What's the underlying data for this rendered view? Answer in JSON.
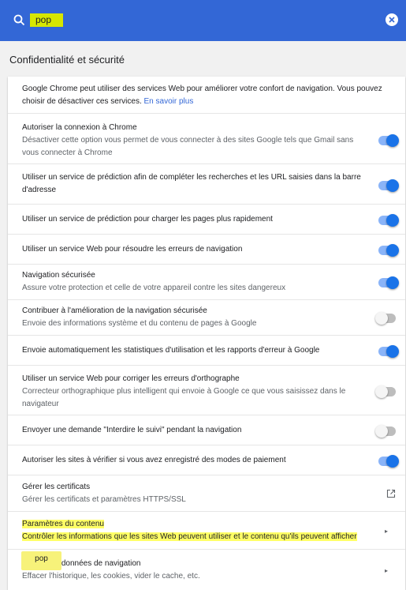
{
  "search": {
    "value": "pop"
  },
  "section": {
    "title": "Confidentialité et sécurité"
  },
  "intro": {
    "text": "Google Chrome peut utiliser des services Web pour améliorer votre confort de navigation. Vous pouvez choisir de désactiver ces services.",
    "link": "En savoir plus"
  },
  "settings": [
    {
      "label": "Autoriser la connexion à Chrome",
      "desc": "Désactiver cette option vous permet de vous connecter à des sites Google tels que Gmail sans vous connecter à Chrome",
      "state": "on"
    },
    {
      "label": "Utiliser un service de prédiction afin de compléter les recherches et les URL saisies dans la barre d'adresse",
      "desc": "",
      "state": "on"
    },
    {
      "label": "Utiliser un service de prédiction pour charger les pages plus rapidement",
      "desc": "",
      "state": "on"
    },
    {
      "label": "Utiliser un service Web pour résoudre les erreurs de navigation",
      "desc": "",
      "state": "on"
    },
    {
      "label": "Navigation sécurisée",
      "desc": "Assure votre protection et celle de votre appareil contre les sites dangereux",
      "state": "on"
    },
    {
      "label": "Contribuer à l'amélioration de la navigation sécurisée",
      "desc": "Envoie des informations système et du contenu de pages à Google",
      "state": "off"
    },
    {
      "label": "Envoie automatiquement les statistiques d'utilisation et les rapports d'erreur à Google",
      "desc": "",
      "state": "on"
    },
    {
      "label": "Utiliser un service Web pour corriger les erreurs d'orthographe",
      "desc": "Correcteur orthographique plus intelligent qui envoie à Google ce que vous saisissez dans le navigateur",
      "state": "off"
    },
    {
      "label": "Envoyer une demande \"Interdire le suivi\" pendant la navigation",
      "desc": "",
      "state": "off"
    },
    {
      "label": "Autoriser les sites à vérifier si vous avez enregistré des modes de paiement",
      "desc": "",
      "state": "on"
    }
  ],
  "certificates": {
    "label": "Gérer les certificats",
    "desc": "Gérer les certificats et paramètres HTTPS/SSL"
  },
  "content": {
    "label": "Paramètres du contenu",
    "desc": "Contrôler les informations que les sites Web peuvent utiliser et le contenu qu'ils peuvent afficher"
  },
  "clear": {
    "label": "Effacer les données de navigation",
    "desc": "Effacer l'historique, les cookies, vider le cache, etc."
  },
  "bubble": {
    "text": "pop"
  },
  "colors": {
    "accent": "#3367d6",
    "highlight": "#ffff66",
    "toggle_on": "#1a73e8"
  }
}
